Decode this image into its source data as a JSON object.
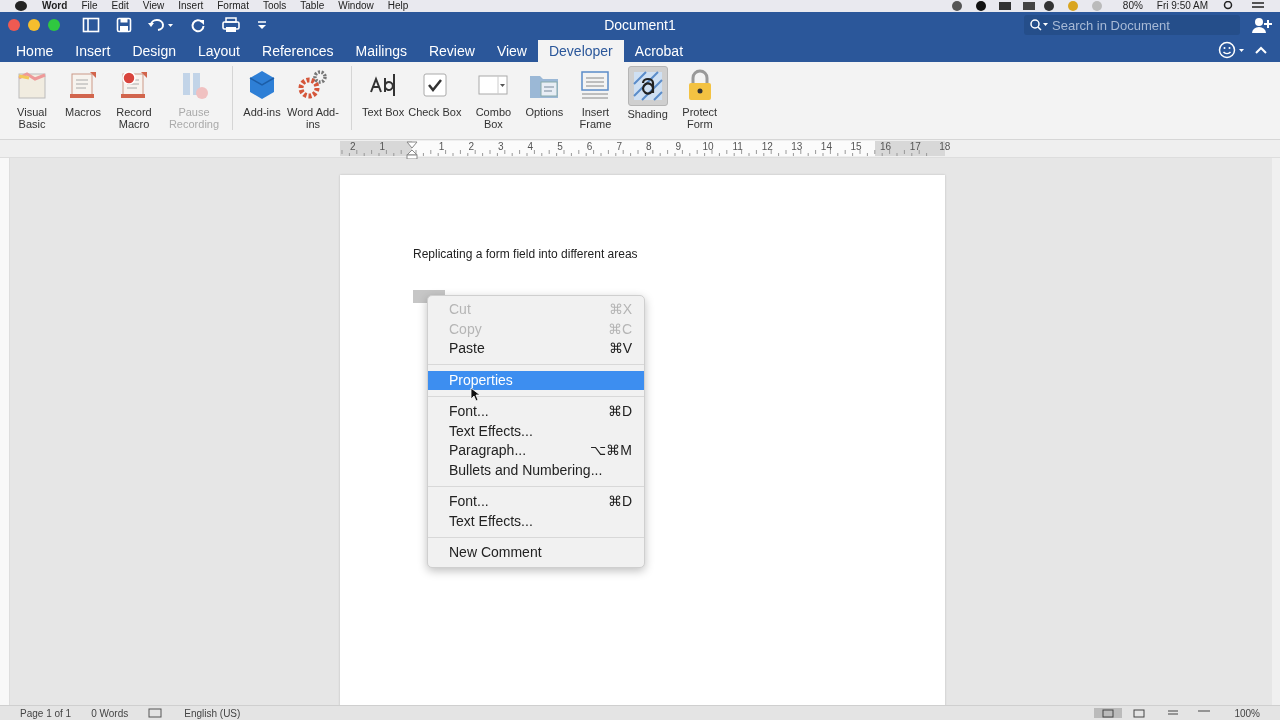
{
  "menubar": {
    "items": [
      "Word",
      "File",
      "Edit",
      "View",
      "Insert",
      "Format",
      "Tools",
      "Table",
      "Window",
      "Help"
    ],
    "battery": "80%",
    "clock": "Fri 9:50 AM"
  },
  "window": {
    "title": "Document1",
    "search": {
      "placeholder": "Search in Document"
    }
  },
  "tabs": [
    {
      "label": "Home",
      "selected": false
    },
    {
      "label": "Insert",
      "selected": false
    },
    {
      "label": "Design",
      "selected": false
    },
    {
      "label": "Layout",
      "selected": false
    },
    {
      "label": "References",
      "selected": false
    },
    {
      "label": "Mailings",
      "selected": false
    },
    {
      "label": "Review",
      "selected": false
    },
    {
      "label": "View",
      "selected": false
    },
    {
      "label": "Developer",
      "selected": true
    },
    {
      "label": "Acrobat",
      "selected": false
    }
  ],
  "ribbon": {
    "groups": [
      [
        {
          "label": "Visual Basic",
          "disabled": false,
          "pressed": false
        },
        {
          "label": "Macros",
          "disabled": false,
          "pressed": false
        },
        {
          "label": "Record Macro",
          "disabled": false,
          "pressed": false
        },
        {
          "label": "Pause Recording",
          "disabled": true,
          "pressed": false
        }
      ],
      [
        {
          "label": "Add-ins",
          "disabled": false,
          "pressed": false
        },
        {
          "label": "Word Add-ins",
          "disabled": false,
          "pressed": false
        }
      ],
      [
        {
          "label": "Text Box",
          "disabled": false,
          "pressed": false
        },
        {
          "label": "Check Box",
          "disabled": false,
          "pressed": false
        },
        {
          "label": "Combo Box",
          "disabled": false,
          "pressed": false
        },
        {
          "label": "Options",
          "disabled": false,
          "pressed": false
        },
        {
          "label": "Insert Frame",
          "disabled": false,
          "pressed": false
        },
        {
          "label": "Shading",
          "disabled": false,
          "pressed": true
        },
        {
          "label": "Protect Form",
          "disabled": false,
          "pressed": false
        }
      ]
    ]
  },
  "ruler": {
    "left_labels": [
      "2",
      "1"
    ],
    "right_labels": [
      "1",
      "2",
      "3",
      "4",
      "5",
      "6",
      "7",
      "8",
      "9",
      "10",
      "11",
      "12",
      "13",
      "14",
      "15",
      "16",
      "17",
      "18"
    ]
  },
  "document": {
    "paragraph": "Replicating a form field into different areas"
  },
  "context_menu": [
    {
      "kind": "item",
      "label": "Cut",
      "shortcut": "⌘X",
      "disabled": true,
      "selected": false
    },
    {
      "kind": "item",
      "label": "Copy",
      "shortcut": "⌘C",
      "disabled": true,
      "selected": false
    },
    {
      "kind": "item",
      "label": "Paste",
      "shortcut": "⌘V",
      "disabled": false,
      "selected": false
    },
    {
      "kind": "separator"
    },
    {
      "kind": "item",
      "label": "Properties",
      "disabled": false,
      "selected": true
    },
    {
      "kind": "separator"
    },
    {
      "kind": "item",
      "label": "Font...",
      "shortcut": "⌘D",
      "disabled": false,
      "selected": false
    },
    {
      "kind": "item",
      "label": "Text Effects...",
      "disabled": false,
      "selected": false
    },
    {
      "kind": "item",
      "label": "Paragraph...",
      "shortcut": "⌥⌘M",
      "disabled": false,
      "selected": false
    },
    {
      "kind": "item",
      "label": "Bullets and Numbering...",
      "disabled": false,
      "selected": false
    },
    {
      "kind": "separator"
    },
    {
      "kind": "item",
      "label": "Font...",
      "shortcut": "⌘D",
      "disabled": false,
      "selected": false
    },
    {
      "kind": "item",
      "label": "Text Effects...",
      "disabled": false,
      "selected": false
    },
    {
      "kind": "separator"
    },
    {
      "kind": "item",
      "label": "New Comment",
      "disabled": false,
      "selected": false
    }
  ],
  "status_bar": {
    "page": "Page 1 of 1",
    "words": "0 Words",
    "language": "English (US)",
    "zoom": "100%"
  }
}
